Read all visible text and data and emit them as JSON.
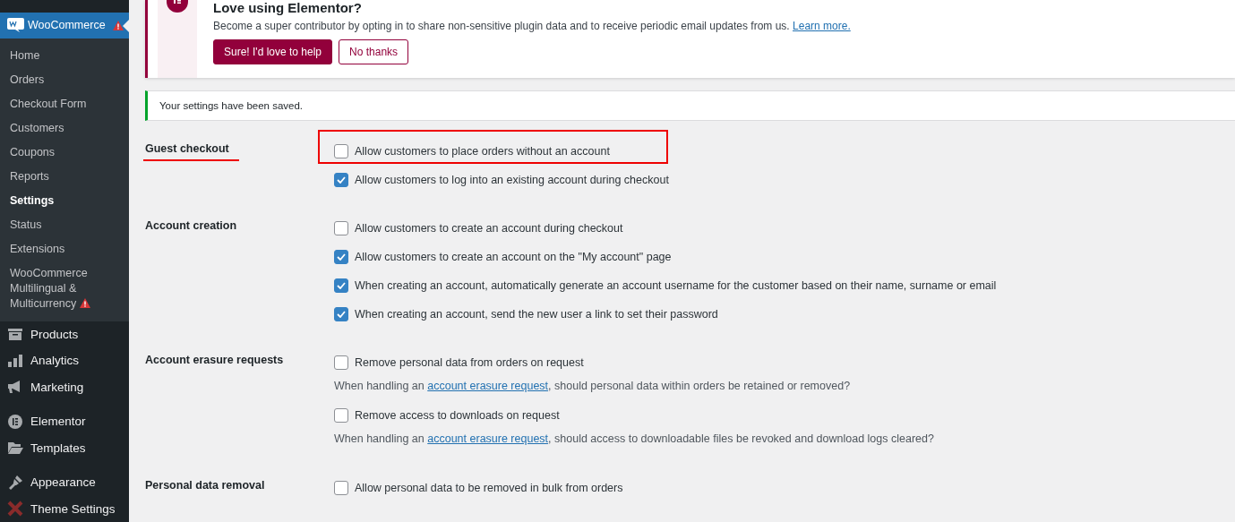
{
  "sidebar": {
    "current": {
      "label": "WooCommerce",
      "warning": true
    },
    "submenu": [
      {
        "label": "Home",
        "selected": false,
        "warning": false
      },
      {
        "label": "Orders",
        "selected": false,
        "warning": false
      },
      {
        "label": "Checkout Form",
        "selected": false,
        "warning": false
      },
      {
        "label": "Customers",
        "selected": false,
        "warning": false
      },
      {
        "label": "Coupons",
        "selected": false,
        "warning": false
      },
      {
        "label": "Reports",
        "selected": false,
        "warning": false
      },
      {
        "label": "Settings",
        "selected": true,
        "warning": false
      },
      {
        "label": "Status",
        "selected": false,
        "warning": false
      },
      {
        "label": "Extensions",
        "selected": false,
        "warning": false
      },
      {
        "label": "WooCommerce Multilingual & Multicurrency",
        "selected": false,
        "warning": true
      }
    ],
    "menu": [
      {
        "label": "Products",
        "group_start": false
      },
      {
        "label": "Analytics",
        "group_start": false
      },
      {
        "label": "Marketing",
        "group_start": false
      },
      {
        "label": "Elementor",
        "group_start": true
      },
      {
        "label": "Templates",
        "group_start": false
      },
      {
        "label": "Appearance",
        "group_start": true
      },
      {
        "label": "Theme Settings",
        "group_start": false
      }
    ]
  },
  "promo": {
    "title": "Love using Elementor?",
    "text": "Become a super contributor by opting in to share non-sensitive plugin data and to receive periodic email updates from us.",
    "link": "Learn more.",
    "primary_button": "Sure! I'd love to help",
    "secondary_button": "No thanks"
  },
  "notice": {
    "text": "Your settings have been saved."
  },
  "sections": [
    {
      "label": "Guest checkout",
      "underlined": true,
      "items": [
        {
          "kind": "checkbox",
          "label": "Allow customers to place orders without an account",
          "checked": false,
          "highlighted": true
        },
        {
          "kind": "checkbox",
          "label": "Allow customers to log into an existing account during checkout",
          "checked": true,
          "highlighted": false
        }
      ]
    },
    {
      "label": "Account creation",
      "underlined": false,
      "items": [
        {
          "kind": "checkbox",
          "label": "Allow customers to create an account during checkout",
          "checked": false,
          "highlighted": false
        },
        {
          "kind": "checkbox",
          "label": "Allow customers to create an account on the \"My account\" page",
          "checked": true,
          "highlighted": false
        },
        {
          "kind": "checkbox",
          "label": "When creating an account, automatically generate an account username for the customer based on their name, surname or email",
          "checked": true,
          "highlighted": false
        },
        {
          "kind": "checkbox",
          "label": "When creating an account, send the new user a link to set their password",
          "checked": true,
          "highlighted": false
        }
      ]
    },
    {
      "label": "Account erasure requests",
      "underlined": false,
      "items": [
        {
          "kind": "checkbox",
          "label": "Remove personal data from orders on request",
          "checked": false,
          "highlighted": false
        },
        {
          "kind": "description",
          "before": "When handling an",
          "link": "account erasure request",
          "after": ", should personal data within orders be retained or removed?"
        },
        {
          "kind": "checkbox",
          "label": "Remove access to downloads on request",
          "checked": false,
          "highlighted": false
        },
        {
          "kind": "description",
          "before": "When handling an",
          "link": "account erasure request",
          "after": ", should access to downloadable files be revoked and download logs cleared?"
        }
      ]
    },
    {
      "label": "Personal data removal",
      "underlined": false,
      "items": [
        {
          "kind": "checkbox",
          "label": "Allow personal data to be removed in bulk from orders",
          "checked": false,
          "highlighted": false
        }
      ]
    }
  ]
}
